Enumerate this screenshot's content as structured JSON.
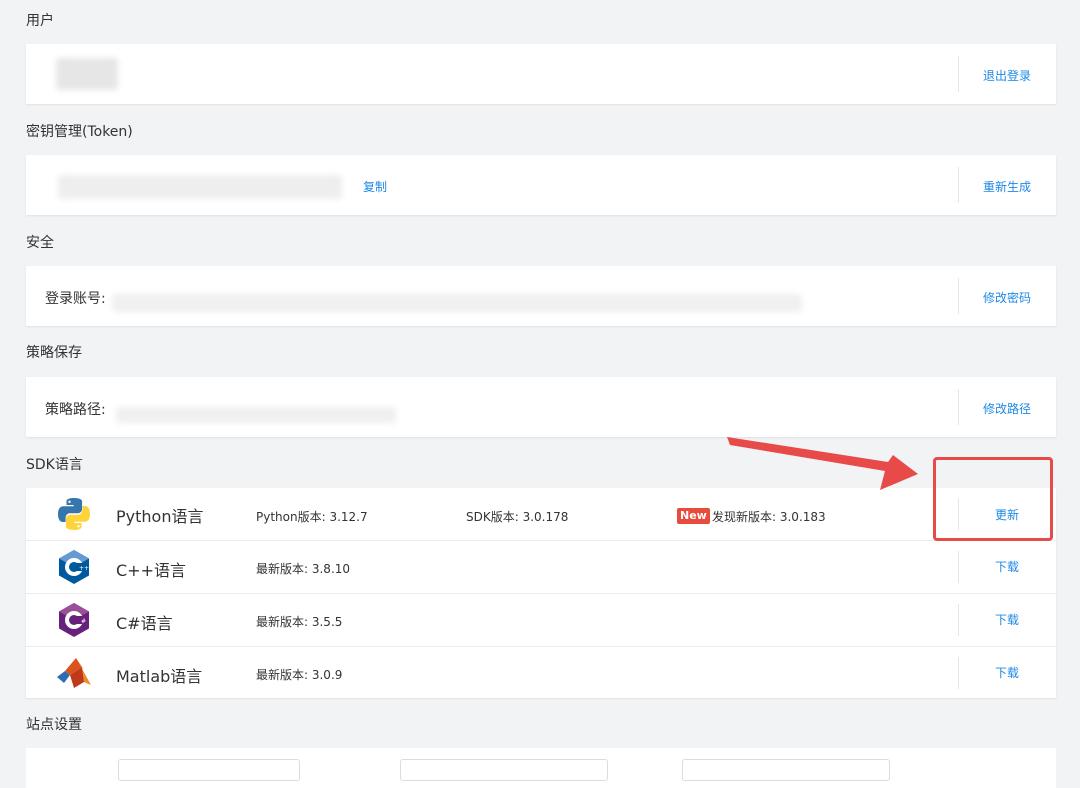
{
  "sections": {
    "user": {
      "title": "用户",
      "action": "退出登录"
    },
    "token": {
      "title": "密钥管理(Token)",
      "copy": "复制",
      "action": "重新生成"
    },
    "security": {
      "title": "安全",
      "label": "登录账号:",
      "action": "修改密码"
    },
    "strategy": {
      "title": "策略保存",
      "label": "策略路径:",
      "action": "修改路径"
    },
    "sdk": {
      "title": "SDK语言",
      "rows": [
        {
          "name": "Python语言",
          "version": "Python版本: 3.12.7",
          "sdk": "SDK版本: 3.0.178",
          "badge": "New",
          "new_version": "发现新版本: 3.0.183",
          "action": "更新",
          "icon": "python-icon"
        },
        {
          "name": "C++语言",
          "version": "最新版本: 3.8.10",
          "action": "下载",
          "icon": "cpp-icon"
        },
        {
          "name": "C#语言",
          "version": "最新版本: 3.5.5",
          "action": "下载",
          "icon": "csharp-icon"
        },
        {
          "name": "Matlab语言",
          "version": "最新版本: 3.0.9",
          "action": "下载",
          "icon": "matlab-icon"
        }
      ]
    },
    "site": {
      "title": "站点设置"
    }
  },
  "colors": {
    "link": "#1e88e5",
    "annotation": "#e84a4a",
    "badge": "#e74c3c"
  }
}
